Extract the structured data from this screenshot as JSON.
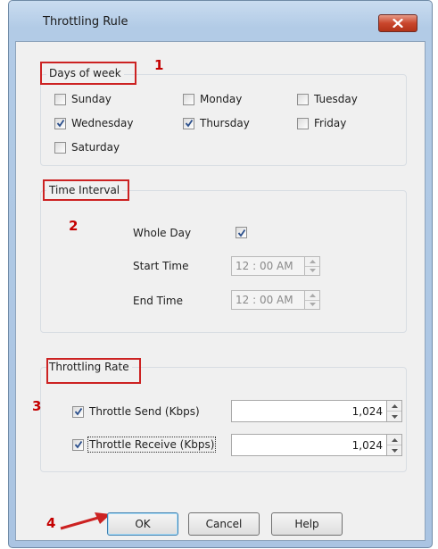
{
  "window": {
    "title": "Throttling Rule",
    "close_icon": "close-icon"
  },
  "days": {
    "group_title": "Days of week",
    "annotation": "1",
    "items": [
      {
        "label": "Sunday",
        "checked": false
      },
      {
        "label": "Monday",
        "checked": false
      },
      {
        "label": "Tuesday",
        "checked": false
      },
      {
        "label": "Wednesday",
        "checked": true
      },
      {
        "label": "Thursday",
        "checked": true
      },
      {
        "label": "Friday",
        "checked": false
      },
      {
        "label": "Saturday",
        "checked": false
      }
    ]
  },
  "time": {
    "group_title": "Time Interval",
    "annotation": "2",
    "whole_day_label": "Whole Day",
    "whole_day_checked": true,
    "start_label": "Start Time",
    "start_value": "12 : 00 AM",
    "end_label": "End Time",
    "end_value": "12 : 00 AM"
  },
  "rate": {
    "group_title": "Throttling Rate",
    "annotation": "3",
    "send_label": "Throttle Send (Kbps)",
    "send_checked": true,
    "send_value": "1,024",
    "receive_label": "Throttle Receive (Kbps)",
    "receive_checked": true,
    "receive_value": "1,024"
  },
  "buttons": {
    "annotation": "4",
    "ok": "OK",
    "cancel": "Cancel",
    "help": "Help"
  },
  "colors": {
    "annotation_red": "#cc2222",
    "frame_blue": "#b2cbe6",
    "close_red": "#c9462c"
  }
}
